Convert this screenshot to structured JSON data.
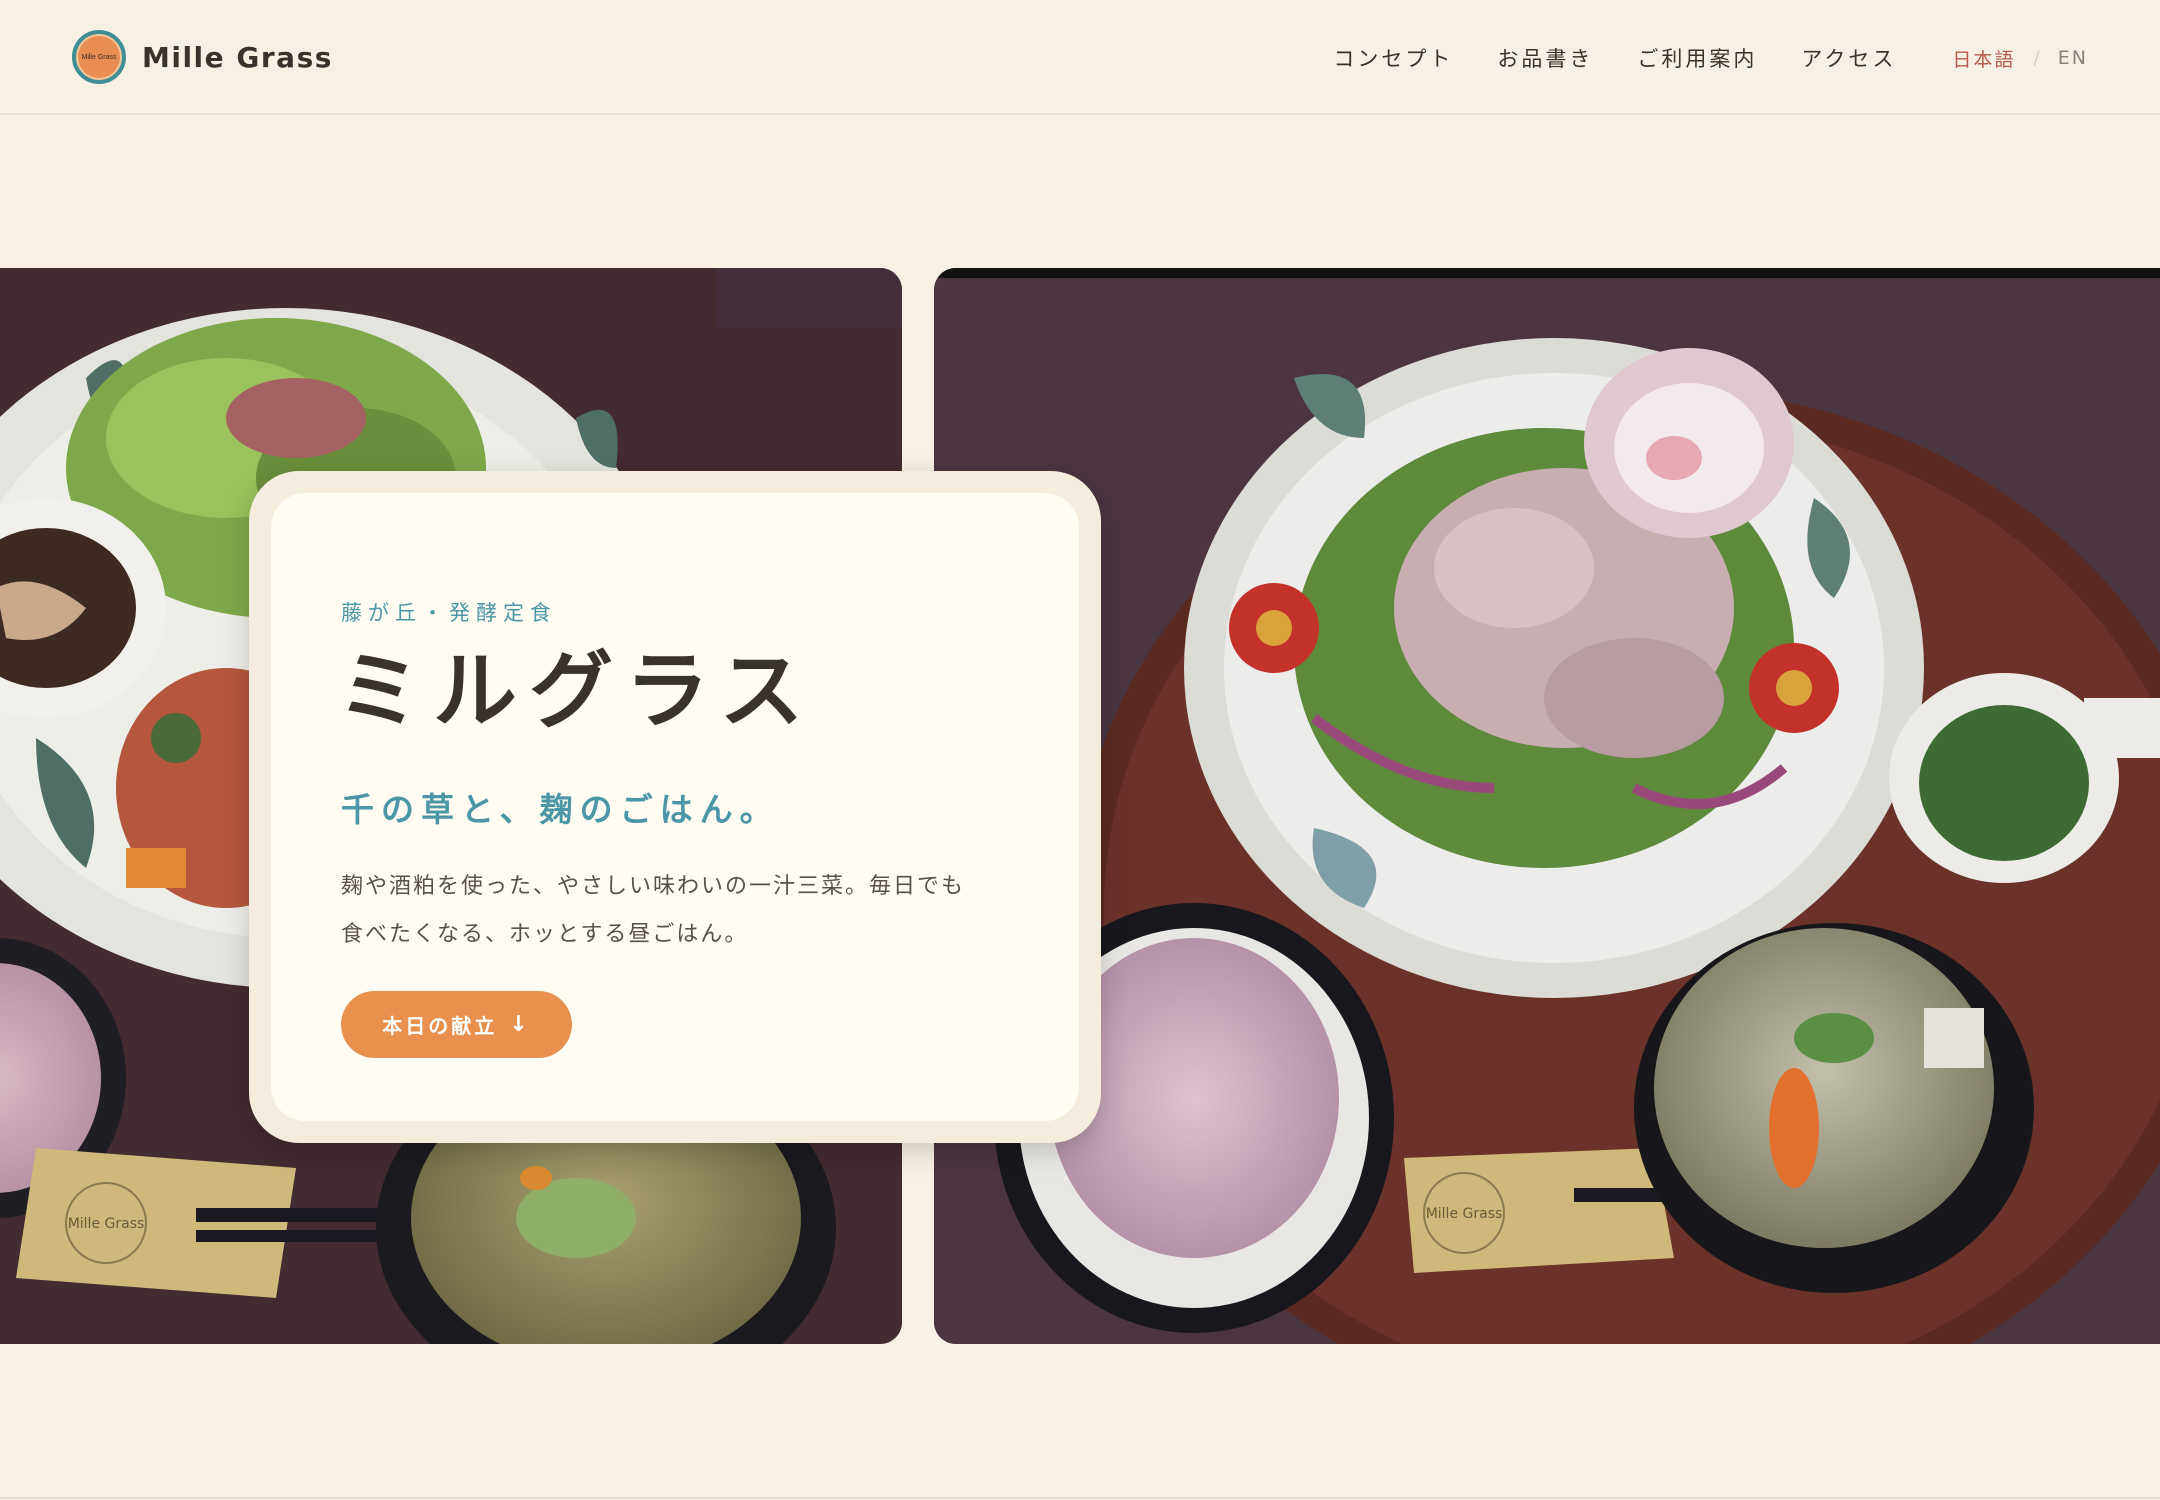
{
  "header": {
    "logo_text": "Mille Grass",
    "brand_name": "Mille Grass",
    "nav": [
      {
        "label": "コンセプト"
      },
      {
        "label": "お品書き"
      },
      {
        "label": "ご利用案内"
      },
      {
        "label": "アクセス"
      }
    ],
    "lang": {
      "ja": "日本語",
      "separator": "/",
      "en": "EN"
    }
  },
  "hero": {
    "eyebrow": "藤が丘・発酵定食",
    "title": "ミルグラス",
    "tagline": "千の草と、麹のごはん。",
    "description_line1": "麹や酒粕を使った、やさしい味わいの一汁三菜。毎日でも",
    "description_line2": "食べたくなる、ホッとする昼ごはん。",
    "cta_label": "本日の献立",
    "cta_arrow": "↓"
  },
  "photos": {
    "left_mat_label": "Mille Grass",
    "right_mat_label": "Mille Grass"
  },
  "colors": {
    "background": "#f7f1e5",
    "accent_teal": "#4c97a5",
    "accent_orange": "#e8914f",
    "lang_active": "#b85a4a"
  }
}
